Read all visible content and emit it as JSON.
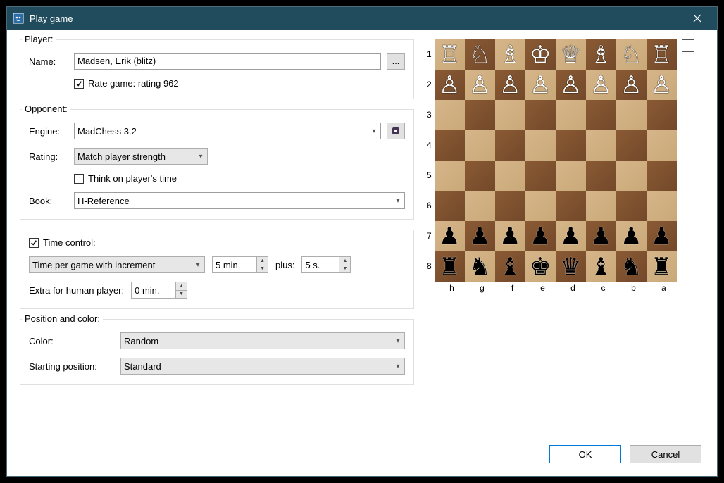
{
  "window": {
    "title": "Play game"
  },
  "player": {
    "legend": "Player:",
    "name_label": "Name:",
    "name_value": "Madsen, Erik (blitz)",
    "browse_btn": "...",
    "rate_checked": true,
    "rate_label": "Rate game: rating 962"
  },
  "opponent": {
    "legend": "Opponent:",
    "engine_label": "Engine:",
    "engine_value": "MadChess 3.2",
    "rating_label": "Rating:",
    "rating_value": "Match player strength",
    "think_checked": false,
    "think_label": "Think on player's time",
    "book_label": "Book:",
    "book_value": "H-Reference"
  },
  "time": {
    "legend": "Time control:",
    "tc_checked": true,
    "mode": "Time per game with increment",
    "time_value": "5 min.",
    "plus_label": "plus:",
    "increment_value": "5 s.",
    "extra_label": "Extra for human player:",
    "extra_value": "0 min."
  },
  "position": {
    "legend": "Position and color:",
    "color_label": "Color:",
    "color_value": "Random",
    "start_label": "Starting position:",
    "start_value": "Standard"
  },
  "buttons": {
    "ok": "OK",
    "cancel": "Cancel"
  },
  "board": {
    "ranks": [
      "1",
      "2",
      "3",
      "4",
      "5",
      "6",
      "7",
      "8"
    ],
    "files": [
      "h",
      "g",
      "f",
      "e",
      "d",
      "c",
      "b",
      "a"
    ],
    "squares": [
      [
        "♖",
        "♘",
        "♗",
        "♔",
        "♕",
        "♗",
        "♘",
        "♖"
      ],
      [
        "♙",
        "♙",
        "♙",
        "♙",
        "♙",
        "♙",
        "♙",
        "♙"
      ],
      [
        "",
        "",
        "",
        "",
        "",
        "",
        "",
        ""
      ],
      [
        "",
        "",
        "",
        "",
        "",
        "",
        "",
        ""
      ],
      [
        "",
        "",
        "",
        "",
        "",
        "",
        "",
        ""
      ],
      [
        "",
        "",
        "",
        "",
        "",
        "",
        "",
        ""
      ],
      [
        "♟",
        "♟",
        "♟",
        "♟",
        "♟",
        "♟",
        "♟",
        "♟"
      ],
      [
        "♜",
        "♞",
        "♝",
        "♚",
        "♛",
        "♝",
        "♞",
        "♜"
      ]
    ]
  }
}
